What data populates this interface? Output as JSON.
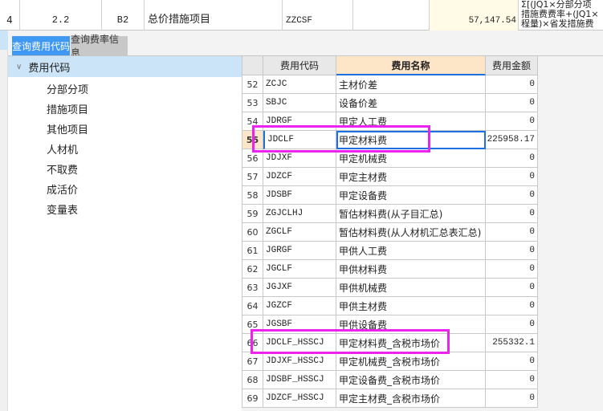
{
  "top_row": {
    "index": "4",
    "number": "2.2",
    "code": "B2",
    "name": "总价措施项目",
    "fee_code": "ZZCSF",
    "amount": "57,147.54",
    "formula": "Σ[(JQ1×分部分项\n措施费费率+(JQ1×\n程量)×省发措施费"
  },
  "tabs": [
    {
      "label": "查询费用代码",
      "active": true
    },
    {
      "label": "查询费率信息",
      "active": false
    }
  ],
  "tree": {
    "root": "费用代码",
    "items": [
      "分部分项",
      "措施项目",
      "其他项目",
      "人材机",
      "不取费",
      "成活价",
      "变量表"
    ]
  },
  "table": {
    "headers": [
      "",
      "费用代码",
      "费用名称",
      "费用金额"
    ],
    "rows": [
      [
        "52",
        "ZCJC",
        "主材价差",
        "0"
      ],
      [
        "53",
        "SBJC",
        "设备价差",
        "0"
      ],
      [
        "54",
        "JDRGF",
        "甲定人工费",
        "0"
      ],
      [
        "55",
        "JDCLF",
        "甲定材料费",
        "225958.17"
      ],
      [
        "56",
        "JDJXF",
        "甲定机械费",
        "0"
      ],
      [
        "57",
        "JDZCF",
        "甲定主材费",
        "0"
      ],
      [
        "58",
        "JDSBF",
        "甲定设备费",
        "0"
      ],
      [
        "59",
        "ZGJCLHJ",
        "暂估材料费(从子目汇总)",
        "0"
      ],
      [
        "60",
        "ZGCLF",
        "暂估材料费(从人材机汇总表汇总)",
        "0"
      ],
      [
        "61",
        "JGRGF",
        "甲供人工费",
        "0"
      ],
      [
        "62",
        "JGCLF",
        "甲供材料费",
        "0"
      ],
      [
        "63",
        "JGJXF",
        "甲供机械费",
        "0"
      ],
      [
        "64",
        "JGZCF",
        "甲供主材费",
        "0"
      ],
      [
        "65",
        "JGSBF",
        "甲供设备费",
        "0"
      ],
      [
        "66",
        "JDCLF_HSSCJ",
        "甲定材料费_含税市场价",
        "255332.1"
      ],
      [
        "67",
        "JDJXF_HSSCJ",
        "甲定机械费_含税市场价",
        "0"
      ],
      [
        "68",
        "JDSBF_HSSCJ",
        "甲定设备费_含税市场价",
        "0"
      ],
      [
        "69",
        "JDZCF_HSSCJ",
        "甲定主材费_含税市场价",
        "0"
      ]
    ],
    "current_row": "55"
  },
  "colors": {
    "tab_active": "#3f99f2",
    "highlight": "#ee22ee",
    "selection": "#1e6fe0"
  }
}
